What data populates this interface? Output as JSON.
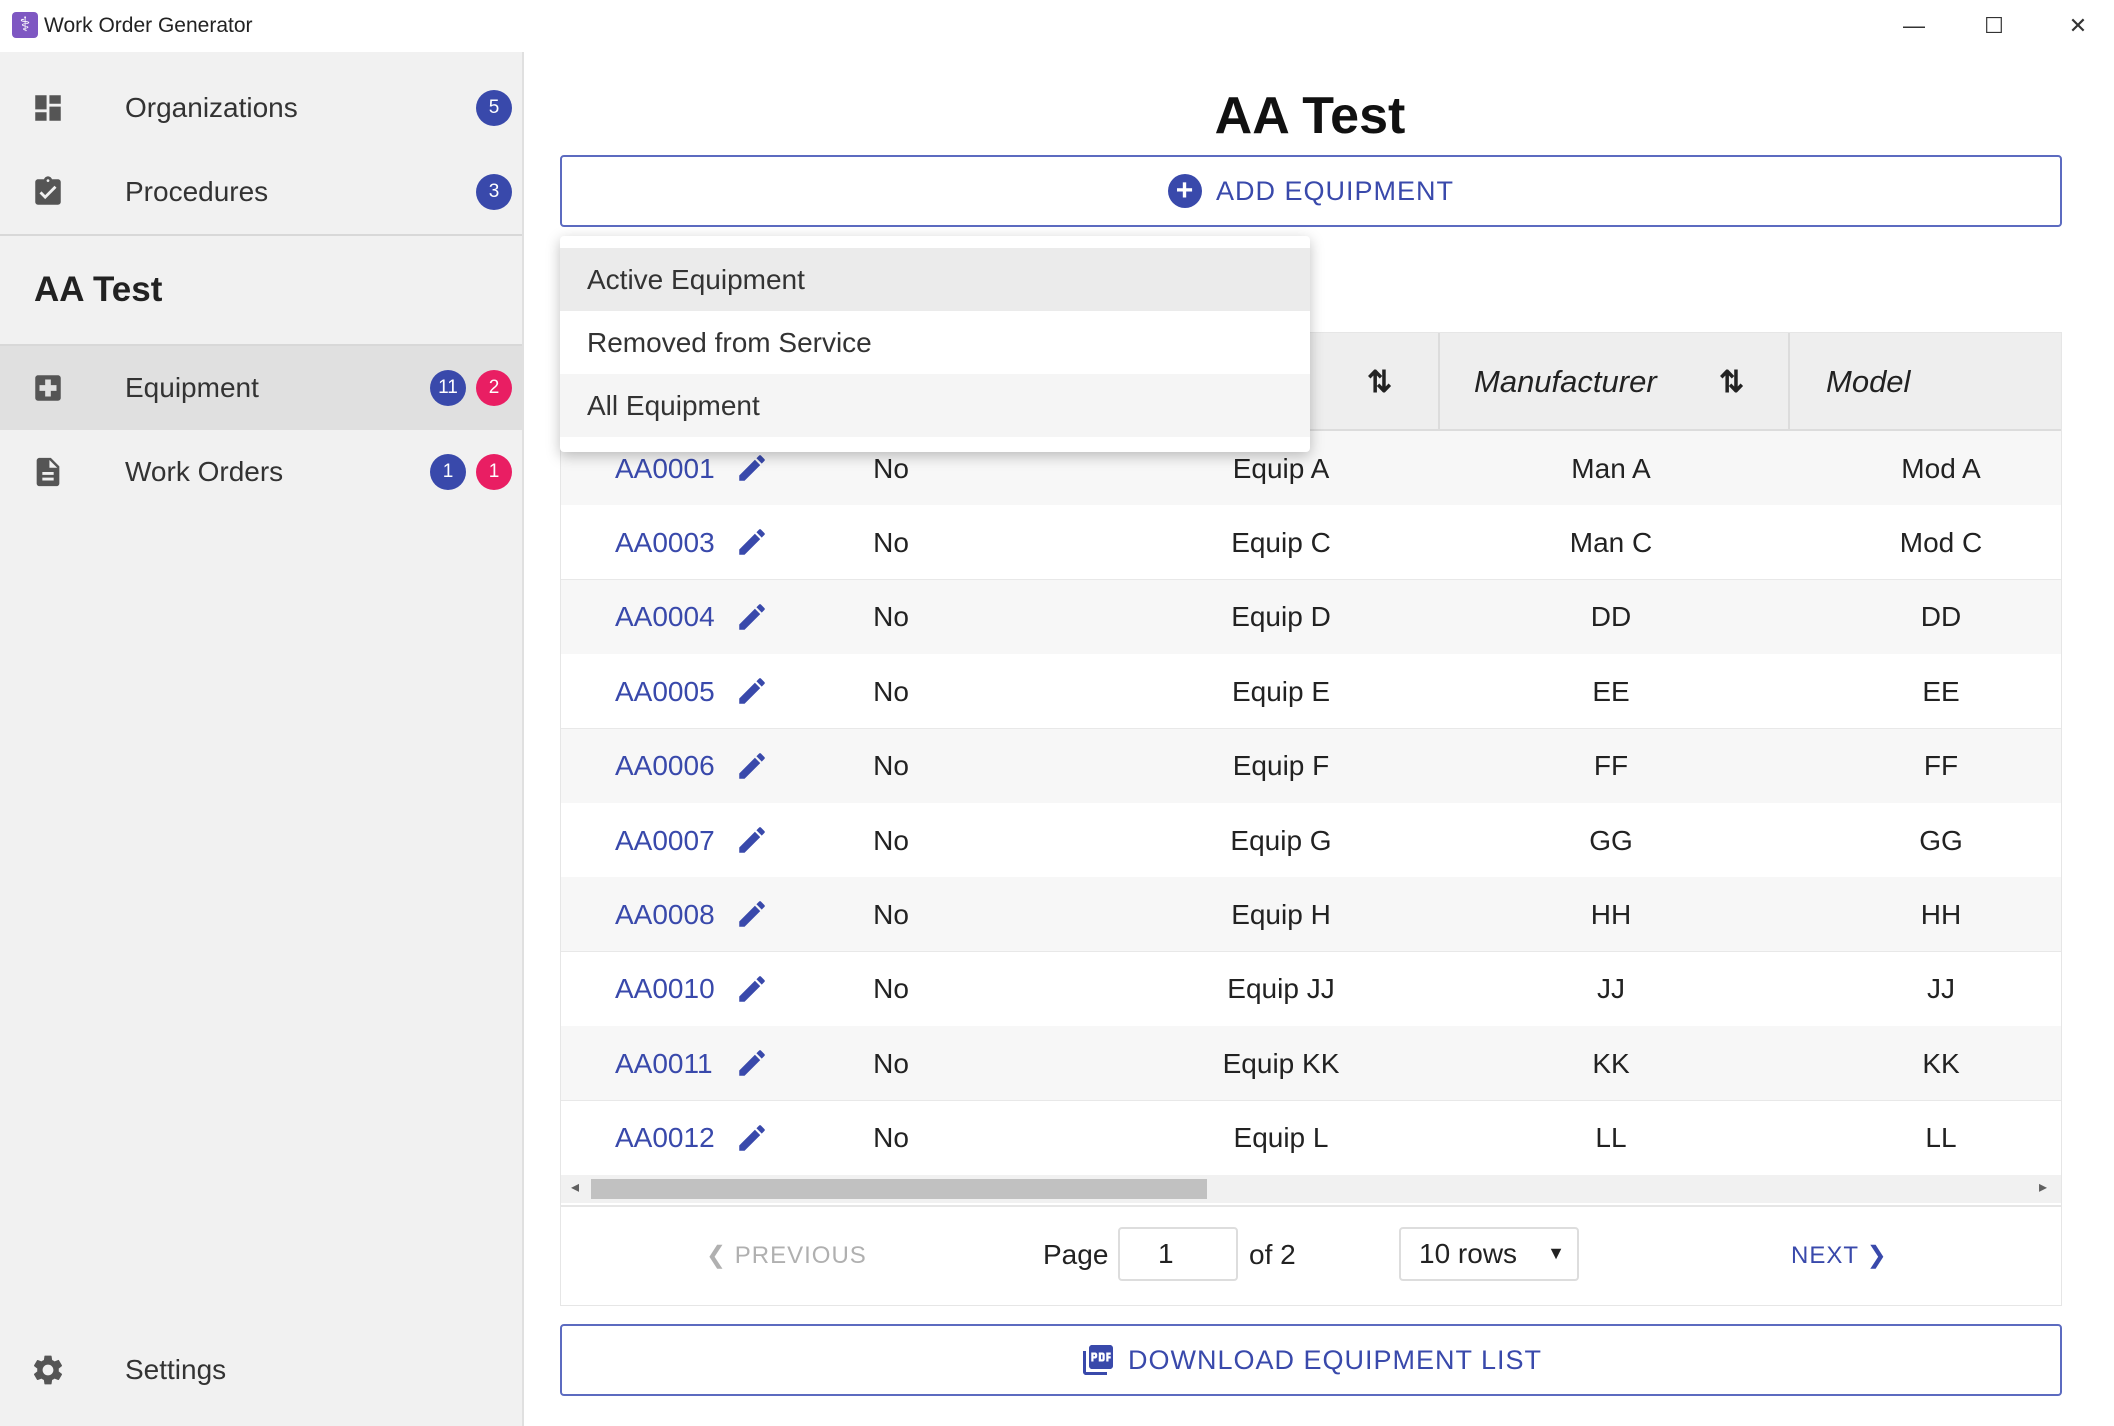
{
  "window": {
    "title": "Work Order Generator",
    "controls": {
      "minimize": "—",
      "maximize": "☐",
      "close": "✕"
    }
  },
  "sidebar": {
    "top_items": [
      {
        "label": "Organizations",
        "icon": "dashboard-icon",
        "badge": "5"
      },
      {
        "label": "Procedures",
        "icon": "clipboard-check-icon",
        "badge": "3"
      }
    ],
    "org_name": "AA Test",
    "org_items": [
      {
        "label": "Equipment",
        "icon": "medical-plus-icon",
        "badge_blue": "11",
        "badge_red": "2",
        "active": true
      },
      {
        "label": "Work Orders",
        "icon": "document-icon",
        "badge_blue": "1",
        "badge_red": "1"
      }
    ],
    "settings_label": "Settings"
  },
  "main": {
    "title": "AA Test",
    "add_button": "ADD EQUIPMENT",
    "filter_menu": {
      "options": [
        "Active Equipment",
        "Removed from Service",
        "All Equipment"
      ],
      "selected": "Active Equipment"
    },
    "table": {
      "headers": {
        "manufacturer": "Manufacturer",
        "model": "Model"
      },
      "rows": [
        {
          "id": "AA0001",
          "removed": "No",
          "description": "Equip A",
          "manufacturer": "Man A",
          "model": "Mod A"
        },
        {
          "id": "AA0003",
          "removed": "No",
          "description": "Equip C",
          "manufacturer": "Man C",
          "model": "Mod C"
        },
        {
          "id": "AA0004",
          "removed": "No",
          "description": "Equip D",
          "manufacturer": "DD",
          "model": "DD"
        },
        {
          "id": "AA0005",
          "removed": "No",
          "description": "Equip E",
          "manufacturer": "EE",
          "model": "EE"
        },
        {
          "id": "AA0006",
          "removed": "No",
          "description": "Equip F",
          "manufacturer": "FF",
          "model": "FF"
        },
        {
          "id": "AA0007",
          "removed": "No",
          "description": "Equip G",
          "manufacturer": "GG",
          "model": "GG"
        },
        {
          "id": "AA0008",
          "removed": "No",
          "description": "Equip H",
          "manufacturer": "HH",
          "model": "HH"
        },
        {
          "id": "AA0010",
          "removed": "No",
          "description": "Equip JJ",
          "manufacturer": "JJ",
          "model": "JJ"
        },
        {
          "id": "AA0011",
          "removed": "No",
          "description": "Equip KK",
          "manufacturer": "KK",
          "model": "KK"
        },
        {
          "id": "AA0012",
          "removed": "No",
          "description": "Equip L",
          "manufacturer": "LL",
          "model": "LL"
        }
      ]
    },
    "pagination": {
      "previous": "PREVIOUS",
      "page_label": "Page",
      "page_value": "1",
      "of_label": "of 2",
      "rows_option": "10 rows",
      "next": "NEXT"
    },
    "download_button": "DOWNLOAD EQUIPMENT LIST"
  },
  "colors": {
    "accent": "#3949ab",
    "badge_red": "#e91e63",
    "sidebar_bg": "#f1f1f1"
  }
}
